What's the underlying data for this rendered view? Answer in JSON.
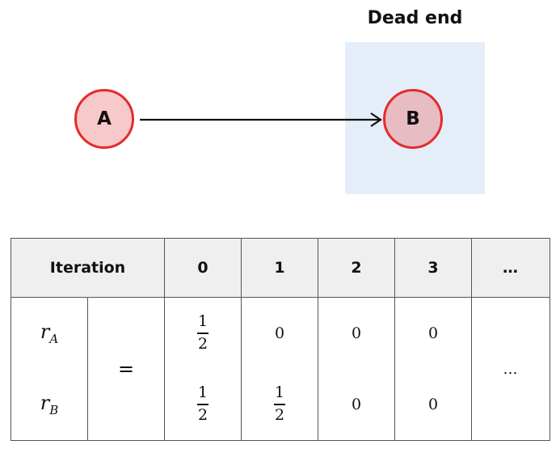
{
  "diagram": {
    "dead_end_title": "Dead end",
    "nodes": [
      {
        "id": "A",
        "label": "A"
      },
      {
        "id": "B",
        "label": "B"
      }
    ],
    "edges": [
      {
        "from": "A",
        "to": "B"
      }
    ],
    "colors": {
      "node_border": "#e42b2b",
      "node_a_fill": "#f8c9c9",
      "node_b_fill": "#e8bcc3",
      "dead_end_bg": "#e4eef8",
      "header_bg": "#efefef"
    }
  },
  "table": {
    "header": {
      "label": "Iteration",
      "cols": [
        "0",
        "1",
        "2",
        "3",
        "…"
      ]
    },
    "rows": [
      {
        "var": "r",
        "sub": "A"
      },
      {
        "var": "r",
        "sub": "B"
      }
    ],
    "equals": "=",
    "cells": {
      "rA": {
        "c0": {
          "num": "1",
          "den": "2"
        },
        "c1": "0",
        "c2": "0",
        "c3": "0"
      },
      "rB": {
        "c0": {
          "num": "1",
          "den": "2"
        },
        "c1": {
          "num": "1",
          "den": "2"
        },
        "c2": "0",
        "c3": "0"
      }
    },
    "ellipsis": "…"
  }
}
